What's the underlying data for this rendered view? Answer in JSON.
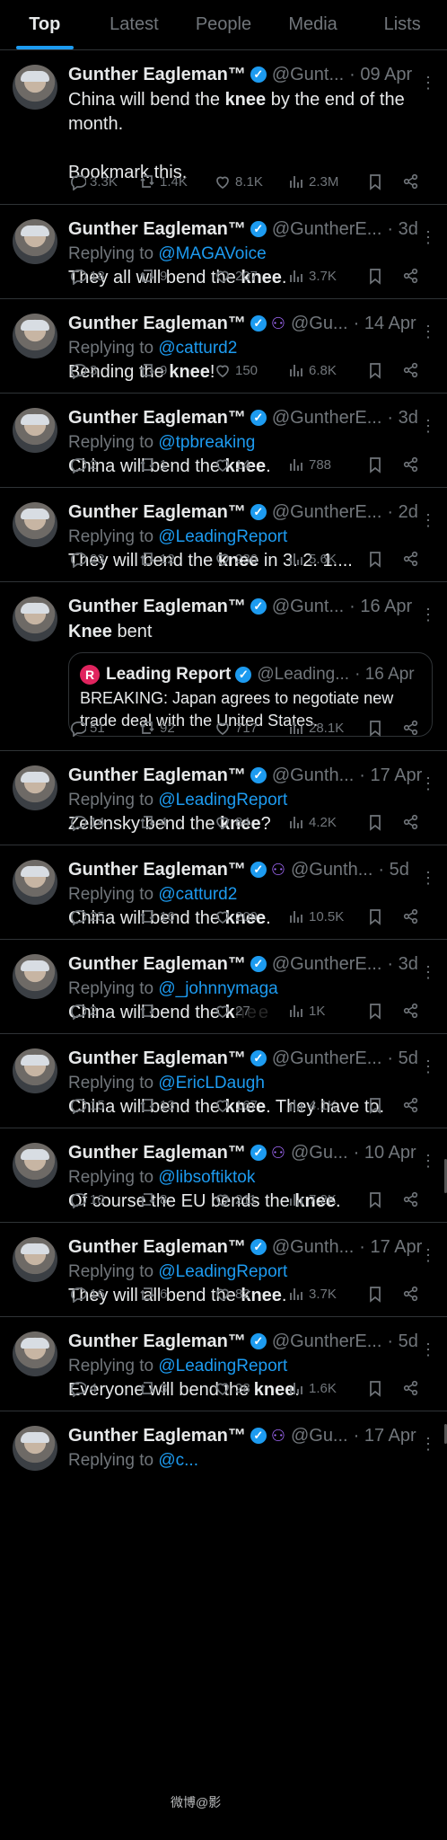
{
  "tabs": [
    "Top",
    "Latest",
    "People",
    "Media",
    "Lists"
  ],
  "colors": {
    "accent": "#1d9bf0",
    "verified": "#1d9bf0",
    "affiliate": "#a66cff",
    "muted": "#71767b"
  },
  "tweets": [
    {
      "name": "Gunther Eagleman™",
      "handle": "@Gunt...",
      "date": "· 09 Apr",
      "reply_to": "",
      "text_html": "China will bend the <b>knee</b> by the end of the month.<br><br>Bookmark this.",
      "replies": "3.3K",
      "retweets": "1.4K",
      "likes": "8.1K",
      "views": "2.3M"
    },
    {
      "name": "Gunther Eagleman™",
      "handle": "@GuntherE...",
      "date": "· 3d",
      "reply_to": "@MAGAVoice",
      "text_html": "They all will bend the <b>knee</b>.",
      "replies": "18",
      "retweets": "9",
      "likes": "207",
      "views": "3.7K"
    },
    {
      "name": "Gunther Eagleman™",
      "handle": "@Gu...",
      "date": "· 14 Apr",
      "affiliate": true,
      "reply_to": "@catturd2",
      "text_html": "Bending the <b>knee</b>!",
      "replies": "3",
      "retweets": "9",
      "likes": "150",
      "views": "6.8K"
    },
    {
      "name": "Gunther Eagleman™",
      "handle": "@GuntherE...",
      "date": "· 3d",
      "reply_to": "@tpbreaking",
      "text_html": "China will bend the <b>knee</b>.",
      "replies": "2",
      "retweets": "1",
      "likes": "14",
      "views": "788"
    },
    {
      "name": "Gunther Eagleman™",
      "handle": "@GuntherE...",
      "date": "· 2d",
      "reply_to": "@LeadingReport",
      "text_html": "They will bend the <b>knee</b> in 3. 2. 1....",
      "replies": "23",
      "retweets": "12",
      "likes": "236",
      "views": "5.6K"
    },
    {
      "name": "Gunther Eagleman™",
      "handle": "@Gunt...",
      "date": "· 16 Apr",
      "reply_to": "",
      "text_html": "<b>Knee</b> bent",
      "quote": {
        "logo": "R",
        "name": "Leading Report",
        "handle": "@Leading...",
        "date": "· 16 Apr",
        "text": "BREAKING: Japan agrees to negotiate new trade deal with the United States."
      },
      "replies": "51",
      "retweets": "92",
      "likes": "717",
      "views": "28.1K"
    },
    {
      "name": "Gunther Eagleman™",
      "handle": "@Gunth...",
      "date": "· 17 Apr",
      "reply_to": "@LeadingReport",
      "text_html": "Zelensky bend the <b>knee</b>?",
      "replies": "14",
      "retweets": "4",
      "likes": "84",
      "views": "4.2K"
    },
    {
      "name": "Gunther Eagleman™",
      "handle": "@Gunth...",
      "date": "· 5d",
      "affiliate": true,
      "reply_to": "@catturd2",
      "text_html": "China will bend the <b>knee</b>.",
      "replies": "25",
      "retweets": "16",
      "likes": "209",
      "views": "10.5K"
    },
    {
      "name": "Gunther Eagleman™",
      "handle": "@GuntherE...",
      "date": "· 3d",
      "reply_to": "@_johnnymaga",
      "text_html": "China will bend the <b>k</b><span class=\"blur\">nee</span>",
      "replies": "2",
      "retweets": "",
      "likes": "27",
      "views": "1K"
    },
    {
      "name": "Gunther Eagleman™",
      "handle": "@GuntherE...",
      "date": "· 5d",
      "reply_to": "@EricLDaugh",
      "text_html": "China will bend the <b>knee</b>.  They have to.",
      "replies": "15",
      "retweets": "13",
      "likes": "167",
      "views": "4.1K"
    },
    {
      "name": "Gunther Eagleman™",
      "handle": "@Gu...",
      "date": "· 10 Apr",
      "affiliate": true,
      "reply_to": "@libsoftiktok",
      "text_html": "Of course the EU bends the <b>knee</b>.",
      "replies": "10",
      "retweets": "8",
      "likes": "211",
      "views": "7.2K"
    },
    {
      "name": "Gunther Eagleman™",
      "handle": "@Gunth...",
      "date": "· 17 Apr",
      "reply_to": "@LeadingReport",
      "text_html": "They will all bend the <b>knee</b>.",
      "replies": "16",
      "retweets": "6",
      "likes": "82",
      "views": "3.7K"
    },
    {
      "name": "Gunther Eagleman™",
      "handle": "@GuntherE...",
      "date": "· 5d",
      "reply_to": "@LeadingReport",
      "text_html": "Everyone will bend the <b>knee</b>.",
      "replies": "4",
      "retweets": "3",
      "likes": "28",
      "views": "1.6K"
    },
    {
      "name": "Gunther Eagleman™",
      "handle": "@Gu...",
      "date": "· 17 Apr",
      "affiliate": true,
      "reply_to": "@c...",
      "text_html": "",
      "replies": "",
      "retweets": "",
      "likes": "",
      "views": ""
    }
  ],
  "labels": {
    "replying_to": "Replying to"
  },
  "watermark": "微博@影"
}
